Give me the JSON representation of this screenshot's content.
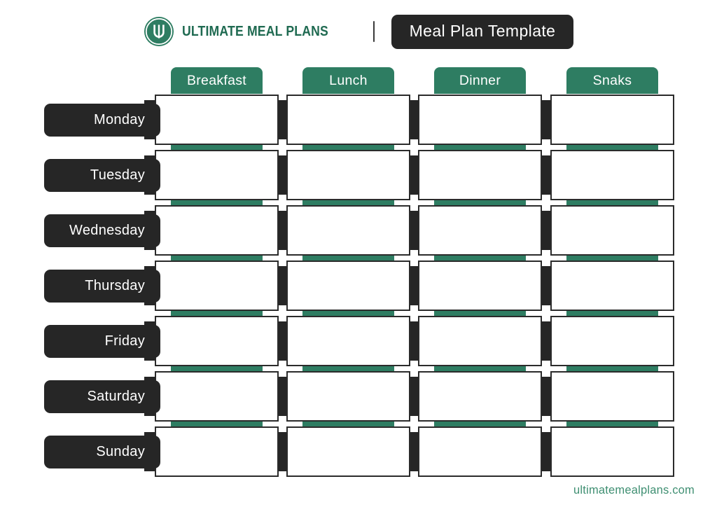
{
  "header": {
    "brand_name": "ULTIMATE MEAL PLANS",
    "logo_icon": "ultimate-meal-plans-logo-icon",
    "divider_icon": "vertical-divider-icon",
    "title": "Meal Plan Template"
  },
  "planner": {
    "columns": [
      {
        "label": "Breakfast"
      },
      {
        "label": "Lunch"
      },
      {
        "label": "Dinner"
      },
      {
        "label": "Snaks"
      }
    ],
    "days": [
      {
        "label": "Monday"
      },
      {
        "label": "Tuesday"
      },
      {
        "label": "Wednesday"
      },
      {
        "label": "Thursday"
      },
      {
        "label": "Friday"
      },
      {
        "label": "Saturday"
      },
      {
        "label": "Sunday"
      }
    ],
    "cell_value": ""
  },
  "footer": {
    "url": "ultimatemealplans.com"
  },
  "colors": {
    "green": "#2e7d62",
    "dark": "#262626",
    "white": "#ffffff",
    "footer_green": "#3f8f72",
    "brand_green": "#1f6a51"
  }
}
